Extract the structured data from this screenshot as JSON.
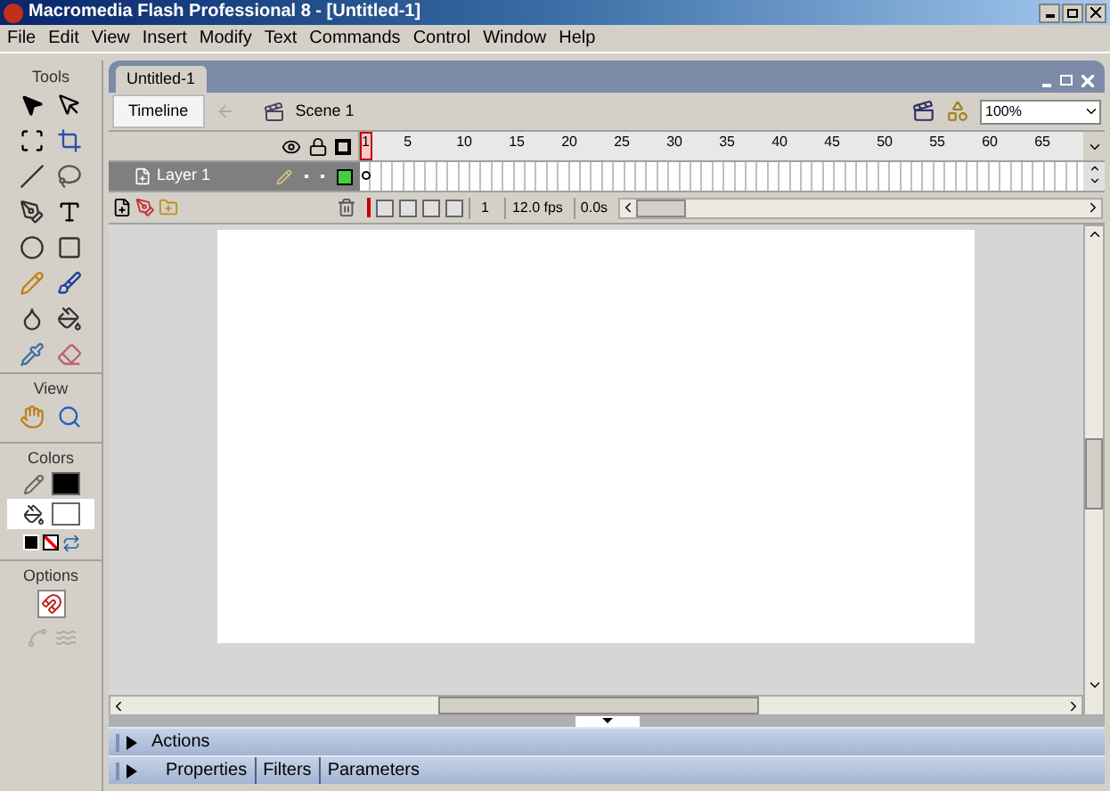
{
  "window": {
    "title": "Macromedia Flash Professional 8 - [Untitled-1]"
  },
  "menu": [
    "File",
    "Edit",
    "View",
    "Insert",
    "Modify",
    "Text",
    "Commands",
    "Control",
    "Window",
    "Help"
  ],
  "tools": {
    "title": "Tools",
    "view_title": "View",
    "colors_title": "Colors",
    "options_title": "Options"
  },
  "document": {
    "tab": "Untitled-1",
    "timeline_button": "Timeline",
    "scene": "Scene 1",
    "zoom": "100%"
  },
  "timeline": {
    "frame_numbers": [
      "1",
      "5",
      "10",
      "15",
      "20",
      "25",
      "30",
      "35",
      "40",
      "45",
      "50",
      "55",
      "60",
      "65"
    ],
    "layers": [
      {
        "name": "Layer 1",
        "selected": true
      }
    ],
    "current_frame": "1",
    "fps": "12.0 fps",
    "time": "0.0s"
  },
  "panels": [
    {
      "tabs": [
        "Actions"
      ],
      "expanded": false
    },
    {
      "tabs": [
        "Properties",
        "Filters",
        "Parameters"
      ],
      "expanded": false
    }
  ]
}
